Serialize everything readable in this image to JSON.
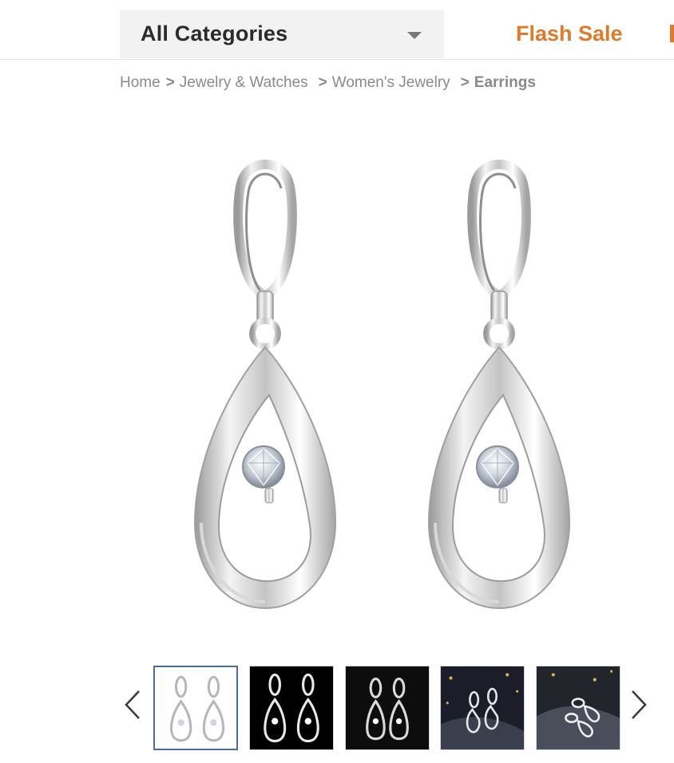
{
  "header": {
    "category_select": {
      "value": "All Categories"
    },
    "flash_sale": "Flash Sale"
  },
  "breadcrumb": {
    "separator": ">",
    "items": [
      "Home",
      "Jewelry & Watches",
      "Women's Jewelry"
    ],
    "current": "Earrings"
  },
  "gallery": {
    "main_image": "silver-teardrop-crystal-drop-earrings",
    "thumbnails": [
      {
        "background": "#ffffff",
        "selected": true
      },
      {
        "background": "#000000",
        "selected": false
      },
      {
        "background": "#0d0d0d",
        "selected": false
      },
      {
        "background": "#1b1e28",
        "selected": false
      },
      {
        "background": "#23252d",
        "selected": false
      }
    ],
    "prev_icon": "chevron-left-icon",
    "next_icon": "chevron-right-icon"
  },
  "colors": {
    "accent": "#e07a2a",
    "thumb_selected_border": "#4a6e99",
    "text_muted": "#8a8a8a"
  }
}
